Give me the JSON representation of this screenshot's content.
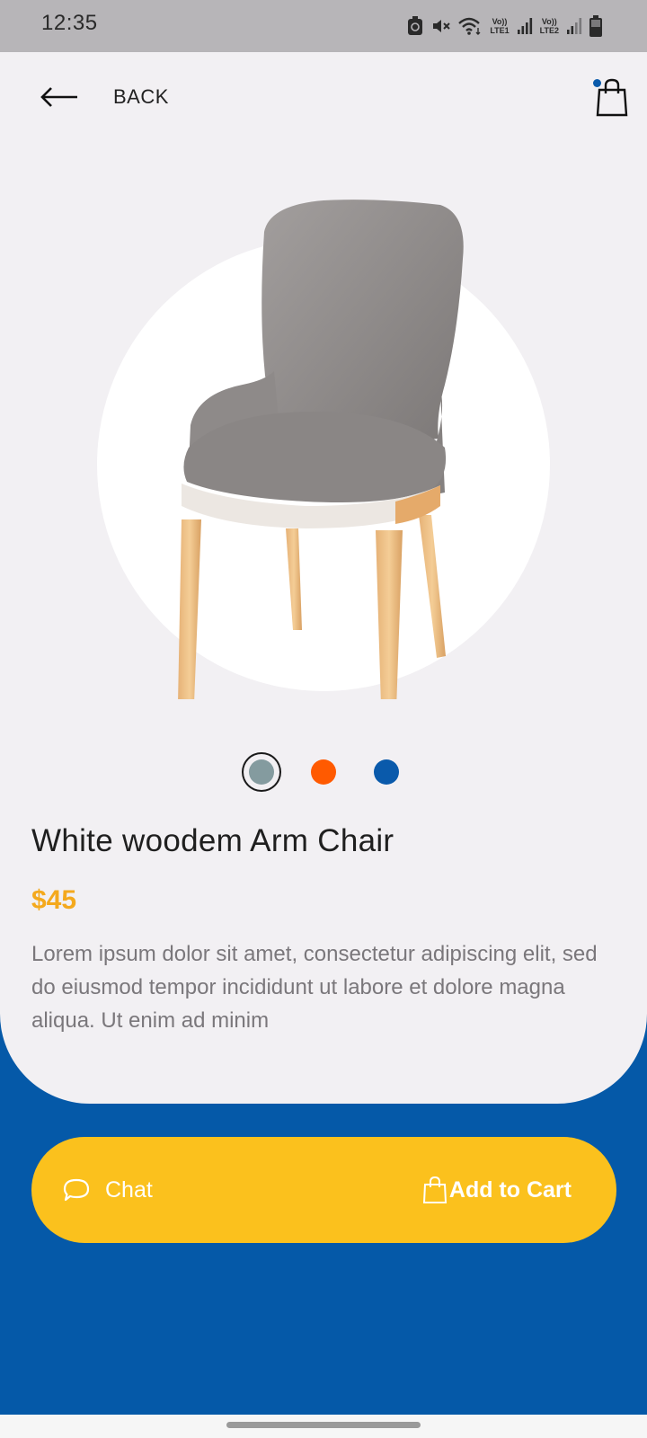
{
  "status_bar": {
    "time": "12:35",
    "sim1": "LTE1",
    "sim2": "LTE2",
    "volte": "Vo))",
    "icons": [
      "recycle-icon",
      "mute-icon",
      "wifi-icon",
      "signal-icon",
      "signal-icon",
      "battery-icon"
    ]
  },
  "header": {
    "back_label": "BACK",
    "cart_has_items": true
  },
  "product": {
    "title": "White woodem Arm Chair",
    "price": "$45",
    "description": "Lorem ipsum dolor sit amet, consectetur adipiscing elit, sed do eiusmod tempor incididunt ut labore et dolore magna aliqua. Ut enim ad minim",
    "colors": [
      {
        "name": "grey",
        "hex": "#849b9f",
        "selected": true
      },
      {
        "name": "orange",
        "hex": "#ff5a00",
        "selected": false
      },
      {
        "name": "blue",
        "hex": "#0a5aab",
        "selected": false
      }
    ]
  },
  "actions": {
    "chat_label": "Chat",
    "add_to_cart_label": "Add to Cart"
  },
  "theme": {
    "background": "#0559a8",
    "card": "#f2f0f3",
    "accent": "#fbc11d",
    "price": "#f4a91d"
  }
}
